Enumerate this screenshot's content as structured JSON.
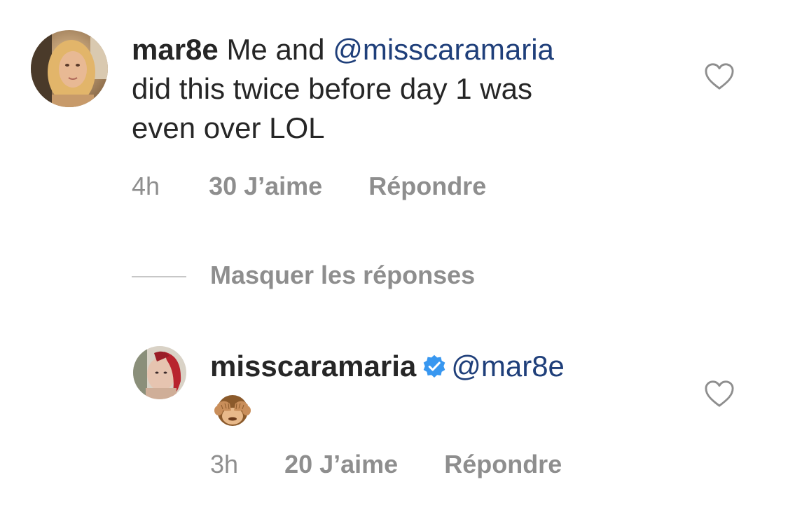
{
  "comment": {
    "username": "mar8e",
    "text_before_mention": "Me and",
    "mention": "@misscaramaria",
    "text_line2": "did this twice before day 1 was",
    "text_line3": "even over LOL",
    "time": "4h",
    "likes": "30 J’aime",
    "reply_label": "Répondre",
    "avatar_icon": "user-avatar-photo",
    "like_icon": "heart-outline-icon"
  },
  "hide_replies": {
    "label": "Masquer les réponses"
  },
  "reply": {
    "username": "misscaramaria",
    "verified_icon": "verified-badge-icon",
    "mention": "@mar8e",
    "emoji": "see-no-evil-monkey",
    "time": "3h",
    "likes": "20 J’aime",
    "reply_label": "Répondre",
    "avatar_icon": "user-avatar-photo",
    "like_icon": "heart-outline-icon"
  },
  "colors": {
    "text": "#262626",
    "secondary": "#8e8e8e",
    "mention": "#1f3f7a",
    "verified": "#3897f0",
    "divider": "#c7c7c7"
  }
}
